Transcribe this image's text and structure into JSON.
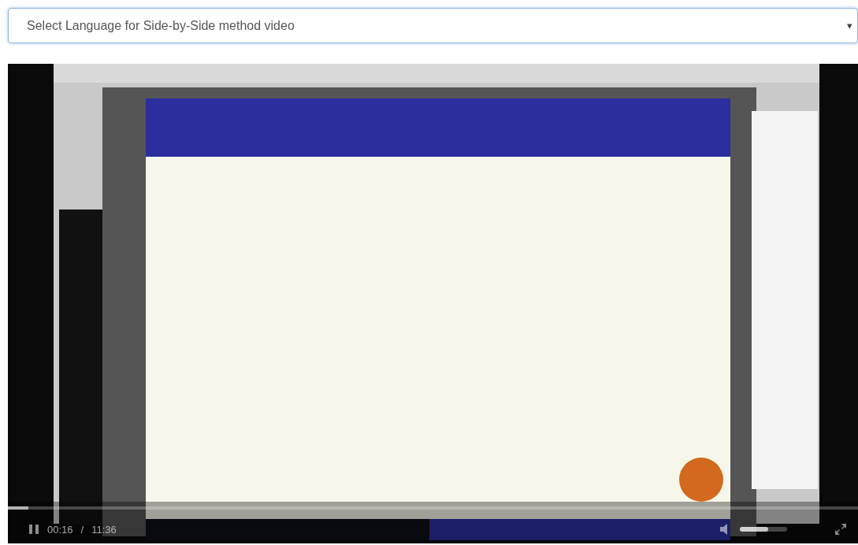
{
  "language_select": {
    "value": "Select Language for Side-by-Side method video",
    "caret": "▾"
  },
  "video": {
    "kind": "picture",
    "progress": {
      "level": 0.024
    },
    "elapsed": "00:16",
    "separator": "/",
    "duration": "11:36",
    "volume": {
      "level": 0.6
    }
  }
}
